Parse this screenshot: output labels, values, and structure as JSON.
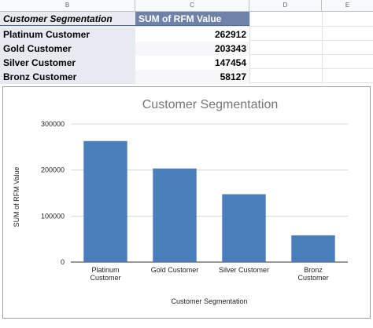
{
  "columns": [
    "B",
    "C",
    "D",
    "E"
  ],
  "pivot": {
    "header": {
      "label": "Customer Segmentation",
      "value": "SUM of RFM Value"
    },
    "rows": [
      {
        "label": "Platinum Customer",
        "value": "262912"
      },
      {
        "label": "Gold Customer",
        "value": "203343"
      },
      {
        "label": "Silver Customer",
        "value": "147454"
      },
      {
        "label": "Bronz Customer",
        "value": "58127"
      }
    ]
  },
  "colors": {
    "bar": "#4a7ebb",
    "header_bg": "#6d83a9",
    "label_bg": "#e8eaf2"
  },
  "chart_data": {
    "type": "bar",
    "title": "Customer Segmentation",
    "xlabel": "Customer Segmentation",
    "ylabel": "SUM of RFM Value",
    "categories": [
      "Platinum Customer",
      "Gold Customer",
      "Silver Customer",
      "Bronz Customer"
    ],
    "category_lines": [
      [
        "Platinum",
        "Customer"
      ],
      [
        "Gold Customer"
      ],
      [
        "Silver Customer"
      ],
      [
        "Bronz",
        "Customer"
      ]
    ],
    "values": [
      262912,
      203343,
      147454,
      58127
    ],
    "ylim": [
      0,
      300000
    ],
    "yticks": [
      0,
      100000,
      200000,
      300000
    ],
    "ytick_labels": [
      "0",
      "100000",
      "200000",
      "300000"
    ],
    "grid": true,
    "legend": "none"
  }
}
